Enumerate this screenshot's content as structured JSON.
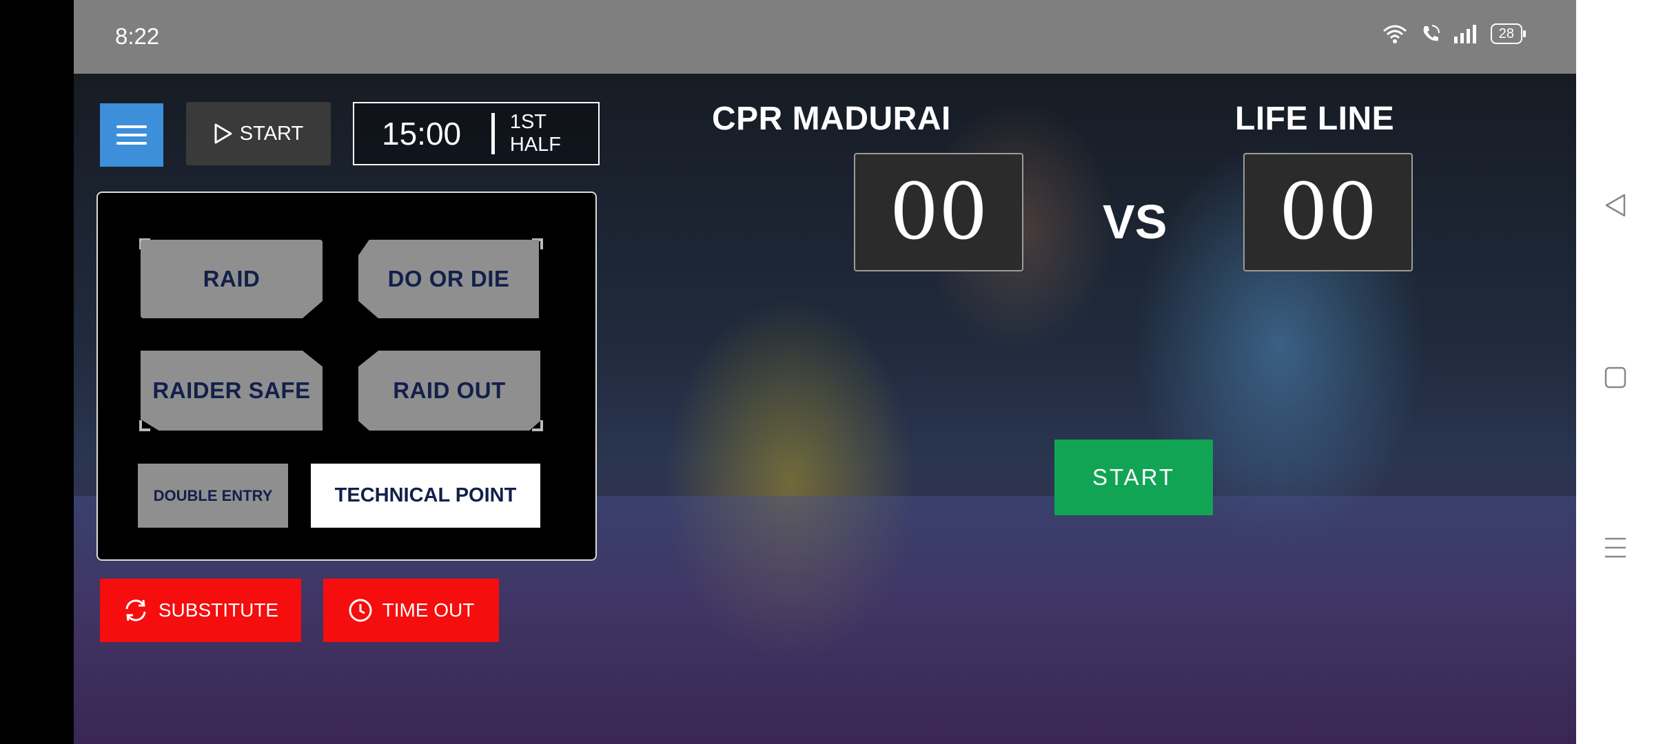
{
  "status_bar": {
    "time": "8:22",
    "battery": "28"
  },
  "top_controls": {
    "start_label": "START",
    "timer": "15:00",
    "half": "1ST HALF"
  },
  "actions": {
    "raid": "RAID",
    "do_or_die": "DO OR DIE",
    "raider_safe": "RAIDER SAFE",
    "raid_out": "RAID OUT",
    "double_entry": "DOUBLE ENTRY",
    "technical_point": "TECHNICAL POINT"
  },
  "bottom_buttons": {
    "substitute": "SUBSTITUTE",
    "time_out": "TIME OUT"
  },
  "match": {
    "team_left": "CPR MADURAI",
    "team_right": "LIFE LINE",
    "score_left": "00",
    "score_right": "00",
    "vs": "VS",
    "start_label": "START"
  },
  "colors": {
    "menu_blue": "#3d8fd9",
    "action_gray": "#8f8f8f",
    "action_text": "#12204a",
    "red": "#f60d0d",
    "green": "#12a455"
  }
}
